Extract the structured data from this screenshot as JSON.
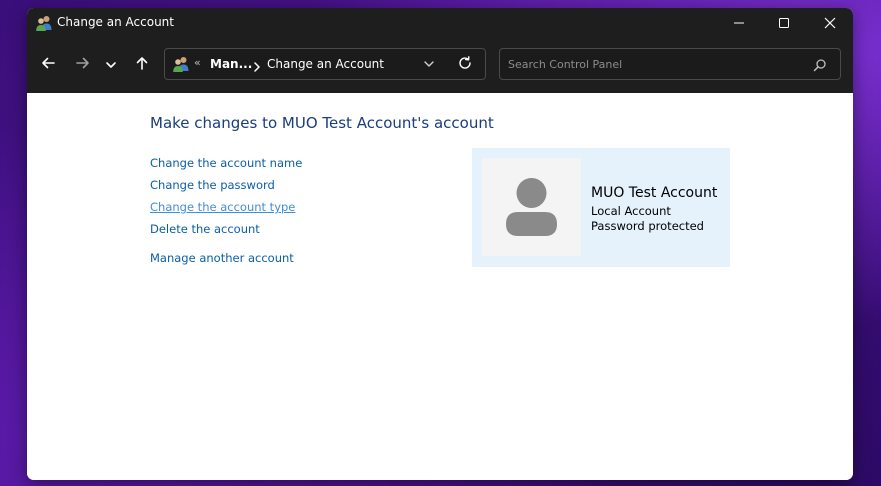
{
  "window": {
    "title": "Change an Account"
  },
  "nav": {
    "back_icon": "arrow-left-icon",
    "forward_icon": "arrow-right-icon",
    "recent_icon": "chevron-down-icon",
    "up_icon": "arrow-up-icon"
  },
  "address": {
    "separator": "«",
    "crumb1": "Man...",
    "crumb2": "Change an Account"
  },
  "search": {
    "placeholder": "Search Control Panel",
    "value": ""
  },
  "main": {
    "heading": "Make changes to MUO Test Account's account",
    "links": {
      "change_name": "Change the account name",
      "change_password": "Change the password",
      "change_type": "Change the account type",
      "delete": "Delete the account",
      "manage_another": "Manage another account"
    }
  },
  "account": {
    "name": "MUO Test Account",
    "type": "Local Account",
    "status": "Password protected"
  },
  "colors": {
    "titlebar": "#1e1e1e",
    "link": "#0a5fa8",
    "link_hover": "#3f8fd8",
    "heading": "#1a3d7c",
    "panel": "#e5f1fb"
  }
}
